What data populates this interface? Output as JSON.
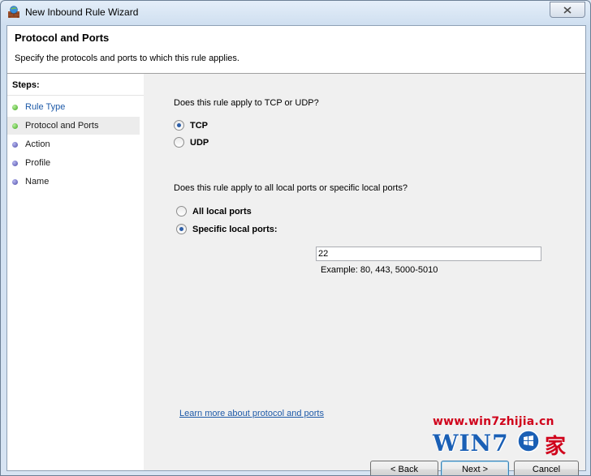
{
  "window": {
    "title": "New Inbound Rule Wizard"
  },
  "header": {
    "title": "Protocol and Ports",
    "subtitle": "Specify the protocols and ports to which this rule applies."
  },
  "steps": {
    "heading": "Steps:",
    "items": [
      {
        "label": "Rule Type",
        "state": "done"
      },
      {
        "label": "Protocol and Ports",
        "state": "current"
      },
      {
        "label": "Action",
        "state": "todo"
      },
      {
        "label": "Profile",
        "state": "todo"
      },
      {
        "label": "Name",
        "state": "todo"
      }
    ]
  },
  "protocol": {
    "question": "Does this rule apply to TCP or UDP?",
    "options": [
      {
        "label": "TCP",
        "selected": true
      },
      {
        "label": "UDP",
        "selected": false
      }
    ]
  },
  "ports": {
    "question": "Does this rule apply to all local ports or specific local ports?",
    "options": [
      {
        "label": "All local ports",
        "selected": false
      },
      {
        "label": "Specific local ports:",
        "selected": true
      }
    ],
    "value": "22",
    "example": "Example: 80, 443, 5000-5010"
  },
  "links": {
    "learn_more": "Learn more about protocol and ports"
  },
  "buttons": {
    "back": "< Back",
    "next": "Next >",
    "cancel": "Cancel"
  },
  "watermark": {
    "url": "www.win7zhijia.cn",
    "logo": "WIN7",
    "char": "家"
  },
  "colors": {
    "accent": "#1e5aa8",
    "step_done": "#3fa61c",
    "step_todo": "#4b4ba8",
    "watermark_red": "#d0021b"
  }
}
